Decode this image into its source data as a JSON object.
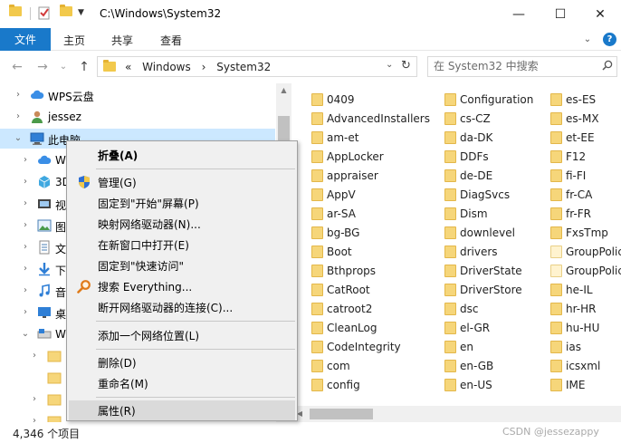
{
  "window": {
    "title": "C:\\Windows\\System32",
    "minimize_glyph": "—",
    "maximize_glyph": "☐",
    "close_glyph": "✕"
  },
  "ribbon": {
    "file_tab": "文件",
    "tabs": [
      "主页",
      "共享",
      "查看"
    ],
    "expand_glyph": "⌄",
    "help_glyph": "?"
  },
  "address": {
    "back_glyph": "←",
    "forward_glyph": "→",
    "recent_glyph": "⌄",
    "up_glyph": "↑",
    "crumbs": [
      "«",
      "Windows",
      "›",
      "System32"
    ],
    "dropdown_glyph": "⌄",
    "refresh_glyph": "↻",
    "search_placeholder": "在 System32 中搜索"
  },
  "nav_tree": [
    {
      "label": "WPS云盘",
      "icon": "cloud-icon",
      "chevron": "›"
    },
    {
      "label": "jessez",
      "icon": "user-icon",
      "chevron": "›"
    },
    {
      "label": "此电脑",
      "icon": "computer-icon",
      "chevron": "⌄",
      "selected": true
    },
    {
      "label": "W",
      "icon": "cloud-icon",
      "chevron": "›"
    },
    {
      "label": "3D",
      "icon": "cube-icon",
      "chevron": "›"
    },
    {
      "label": "视",
      "icon": "video-icon",
      "chevron": "›"
    },
    {
      "label": "图",
      "icon": "picture-icon",
      "chevron": "›"
    },
    {
      "label": "文",
      "icon": "document-icon",
      "chevron": "›"
    },
    {
      "label": "下",
      "icon": "download-icon",
      "chevron": "›"
    },
    {
      "label": "音",
      "icon": "music-icon",
      "chevron": "›"
    },
    {
      "label": "桌",
      "icon": "desktop-icon",
      "chevron": "›"
    },
    {
      "label": "W",
      "icon": "drive-icon",
      "chevron": "⌄"
    },
    {
      "label": "",
      "icon": "folder-icon",
      "chevron": "›"
    },
    {
      "label": "",
      "icon": "folder-icon",
      "chevron": ""
    },
    {
      "label": "",
      "icon": "folder-icon",
      "chevron": "›"
    },
    {
      "label": "",
      "icon": "folder-icon",
      "chevron": "›"
    },
    {
      "label": "",
      "icon": "folder-icon",
      "chevron": "›"
    }
  ],
  "files": {
    "col1": [
      "0409",
      "AdvancedInstallers",
      "am-et",
      "AppLocker",
      "appraiser",
      "AppV",
      "ar-SA",
      "bg-BG",
      "Boot",
      "Bthprops",
      "CatRoot",
      "catroot2",
      "CleanLog",
      "CodeIntegrity",
      "com",
      "config"
    ],
    "col2": [
      "Configuration",
      "cs-CZ",
      "da-DK",
      "DDFs",
      "de-DE",
      "DiagSvcs",
      "Dism",
      "downlevel",
      "drivers",
      "DriverState",
      "DriverStore",
      "dsc",
      "el-GR",
      "en",
      "en-GB",
      "en-US"
    ],
    "col3": [
      "es-ES",
      "es-MX",
      "et-EE",
      "F12",
      "fi-FI",
      "fr-CA",
      "fr-FR",
      "FxsTmp",
      "GroupPolic",
      "GroupPolic",
      "he-IL",
      "hr-HR",
      "hu-HU",
      "ias",
      "icsxml",
      "IME"
    ],
    "col3_plain": [
      false,
      false,
      false,
      false,
      false,
      false,
      false,
      false,
      true,
      true,
      false,
      false,
      false,
      false,
      false,
      false
    ]
  },
  "status": {
    "item_count": "4,346 个项目",
    "watermark": "CSDN @jessezappy"
  },
  "context_menu": {
    "collapse": "折叠(A)",
    "manage": "管理(G)",
    "pin_start": "固定到\"开始\"屏幕(P)",
    "map_drive": "映射网络驱动器(N)...",
    "open_new_window": "在新窗口中打开(E)",
    "pin_quick": "固定到\"快速访问\"",
    "search_everything": "搜索 Everything...",
    "disconnect_drive": "断开网络驱动器的连接(C)...",
    "add_network_location": "添加一个网络位置(L)",
    "delete": "删除(D)",
    "rename": "重命名(M)",
    "properties": "属性(R)"
  },
  "colors": {
    "accent": "#1979ca",
    "selection": "#cce8ff",
    "folder": "#f6d67a",
    "menu_bg": "#f0f0f0"
  }
}
